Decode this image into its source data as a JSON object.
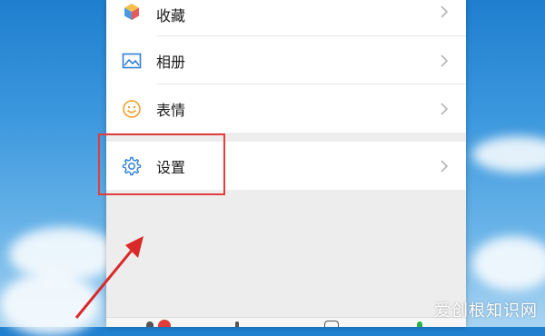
{
  "menu": {
    "items": [
      {
        "label": "收藏",
        "icon": "cube-icon"
      },
      {
        "label": "相册",
        "icon": "image-icon"
      },
      {
        "label": "表情",
        "icon": "smiley-icon"
      }
    ],
    "settings": {
      "label": "设置",
      "icon": "gear-icon"
    }
  },
  "watermark": "爱创根知识网",
  "colors": {
    "highlight": "#e23c3c",
    "blue_icon": "#2f7fd6",
    "orange_icon": "#f0a030",
    "badge_red": "#e23c3c"
  }
}
